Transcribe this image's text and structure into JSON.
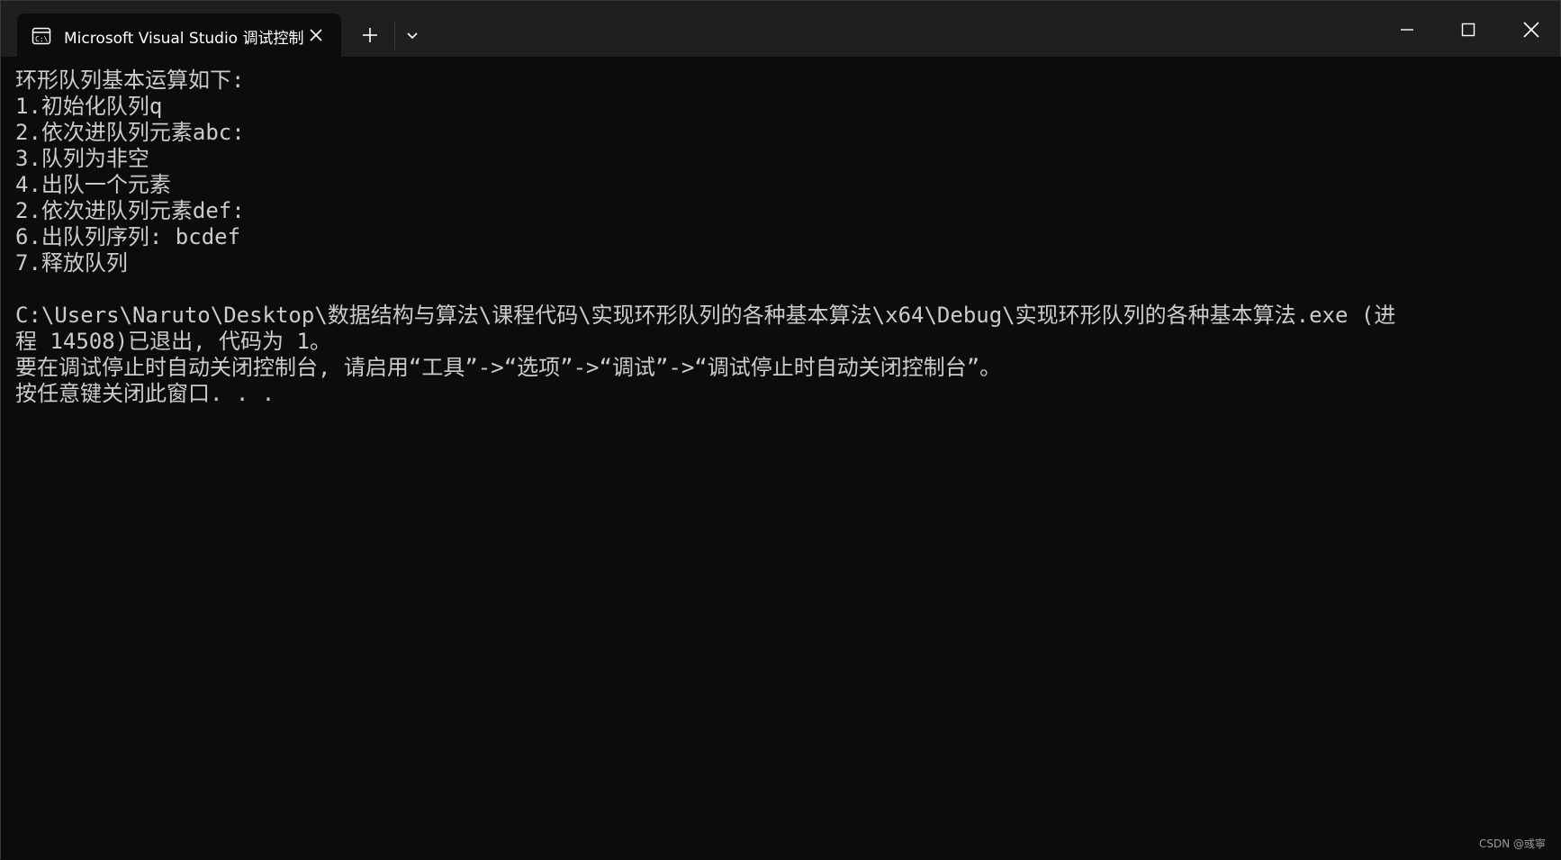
{
  "window": {
    "tab_title": "Microsoft Visual Studio 调试控制台",
    "tab_icon": "console-icon",
    "new_tab_icon": "plus-icon",
    "dropdown_icon": "chevron-down-icon",
    "minimize_icon": "minimize-icon",
    "maximize_icon": "maximize-icon",
    "close_icon": "close-icon"
  },
  "console": {
    "lines": [
      "环形队列基本运算如下:",
      "1.初始化队列q",
      "2.依次进队列元素abc:",
      "3.队列为非空",
      "4.出队一个元素",
      "2.依次进队列元素def:",
      "6.出队列序列: bcdef",
      "7.释放队列",
      "",
      "C:\\Users\\Naruto\\Desktop\\数据结构与算法\\课程代码\\实现环形队列的各种基本算法\\x64\\Debug\\实现环形队列的各种基本算法.exe (进",
      "程 14508)已退出, 代码为 1。",
      "要在调试停止时自动关闭控制台, 请启用“工具”->“选项”->“调试”->“调试停止时自动关闭控制台”。",
      "按任意键关闭此窗口. . ."
    ]
  },
  "watermark": "CSDN @彧寧",
  "colors": {
    "background": "#0c0c0c",
    "titlebar": "#1f1f1f",
    "text": "#cccccc"
  }
}
